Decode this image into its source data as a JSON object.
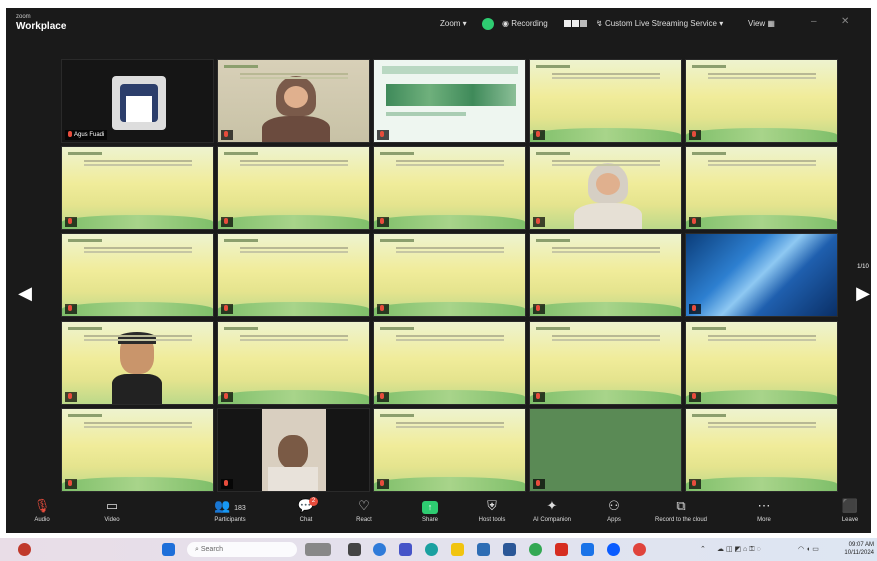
{
  "app": {
    "brand_small": "zoom",
    "brand": "Workplace"
  },
  "titlebar": {
    "view_menu": "Zoom",
    "recording": "Recording",
    "streaming": "Custom Live Streaming Service",
    "view": "View"
  },
  "gallery": {
    "tiles": [
      {
        "name": "Agus Fuadi",
        "kind": "avatar"
      },
      {
        "name": "",
        "kind": "woman-hijab"
      },
      {
        "name": "",
        "kind": "share-slide"
      },
      {
        "name": "",
        "kind": "slide"
      },
      {
        "name": "",
        "kind": "slide"
      },
      {
        "name": "",
        "kind": "slide"
      },
      {
        "name": "",
        "kind": "slide"
      },
      {
        "name": "",
        "kind": "slide"
      },
      {
        "name": "",
        "kind": "woman-hijab-2"
      },
      {
        "name": "",
        "kind": "slide"
      },
      {
        "name": "",
        "kind": "slide"
      },
      {
        "name": "",
        "kind": "slide"
      },
      {
        "name": "",
        "kind": "slide"
      },
      {
        "name": "",
        "kind": "slide"
      },
      {
        "name": "",
        "kind": "blue"
      },
      {
        "name": "",
        "kind": "avatar-man"
      },
      {
        "name": "",
        "kind": "slide"
      },
      {
        "name": "",
        "kind": "slide"
      },
      {
        "name": "",
        "kind": "slide"
      },
      {
        "name": "",
        "kind": "slide"
      },
      {
        "name": "",
        "kind": "slide"
      },
      {
        "name": "",
        "kind": "man-video"
      },
      {
        "name": "",
        "kind": "slide"
      },
      {
        "name": "",
        "kind": "green"
      },
      {
        "name": "",
        "kind": "slide"
      }
    ],
    "page_label": "1/10"
  },
  "toolbar": {
    "audio": "Audio",
    "video": "Video",
    "participants": "Participants",
    "participants_count": "183",
    "chat": "Chat",
    "chat_badge": "2",
    "react": "React",
    "share": "Share",
    "host_tools": "Host tools",
    "ai_companion": "AI Companion",
    "apps": "Apps",
    "recording": "Record to the cloud",
    "more": "More",
    "leave": "Leave"
  },
  "taskbar": {
    "search_placeholder": "Search",
    "time": "09:07 AM",
    "date": "10/11/2024"
  },
  "colors": {
    "accent": "#2ecc71",
    "leave": "#e74c3c",
    "share": "#2ecc71"
  }
}
